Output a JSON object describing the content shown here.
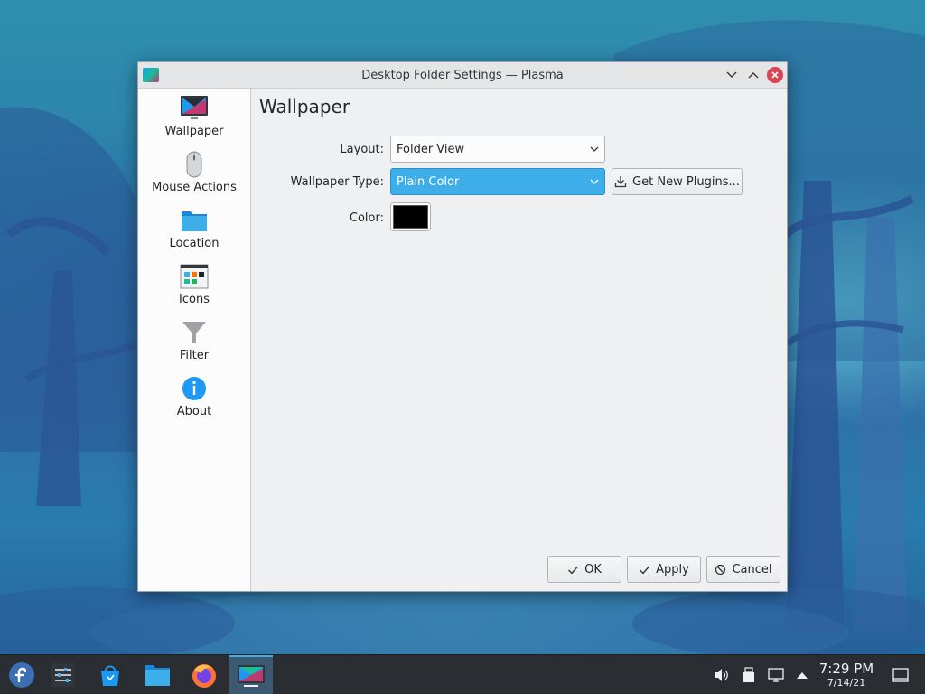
{
  "window": {
    "title": "Desktop Folder Settings — Plasma"
  },
  "sidebar": {
    "items": [
      {
        "label": "Wallpaper",
        "icon": "monitor-icon"
      },
      {
        "label": "Mouse Actions",
        "icon": "mouse-icon"
      },
      {
        "label": "Location",
        "icon": "folder-icon"
      },
      {
        "label": "Icons",
        "icon": "icons-grid-icon"
      },
      {
        "label": "Filter",
        "icon": "filter-icon"
      },
      {
        "label": "About",
        "icon": "info-icon"
      }
    ]
  },
  "main": {
    "title": "Wallpaper",
    "layout_label": "Layout:",
    "layout_value": "Folder View",
    "wallpaper_type_label": "Wallpaper Type:",
    "wallpaper_type_value": "Plain Color",
    "get_plugins_label": "Get New Plugins...",
    "color_label": "Color:",
    "color_value": "#000000"
  },
  "buttons": {
    "ok": "OK",
    "apply": "Apply",
    "cancel": "Cancel"
  },
  "taskbar": {
    "items": [
      "fedora-launcher-icon",
      "system-settings-icon",
      "discover-store-icon",
      "file-manager-icon",
      "firefox-icon",
      "desktop-settings-icon"
    ],
    "clock_time": "7:29 PM",
    "clock_date": "7/14/21"
  },
  "colors": {
    "accent": "#3daee9",
    "close": "#da4453",
    "panel": "#2a2e32"
  }
}
